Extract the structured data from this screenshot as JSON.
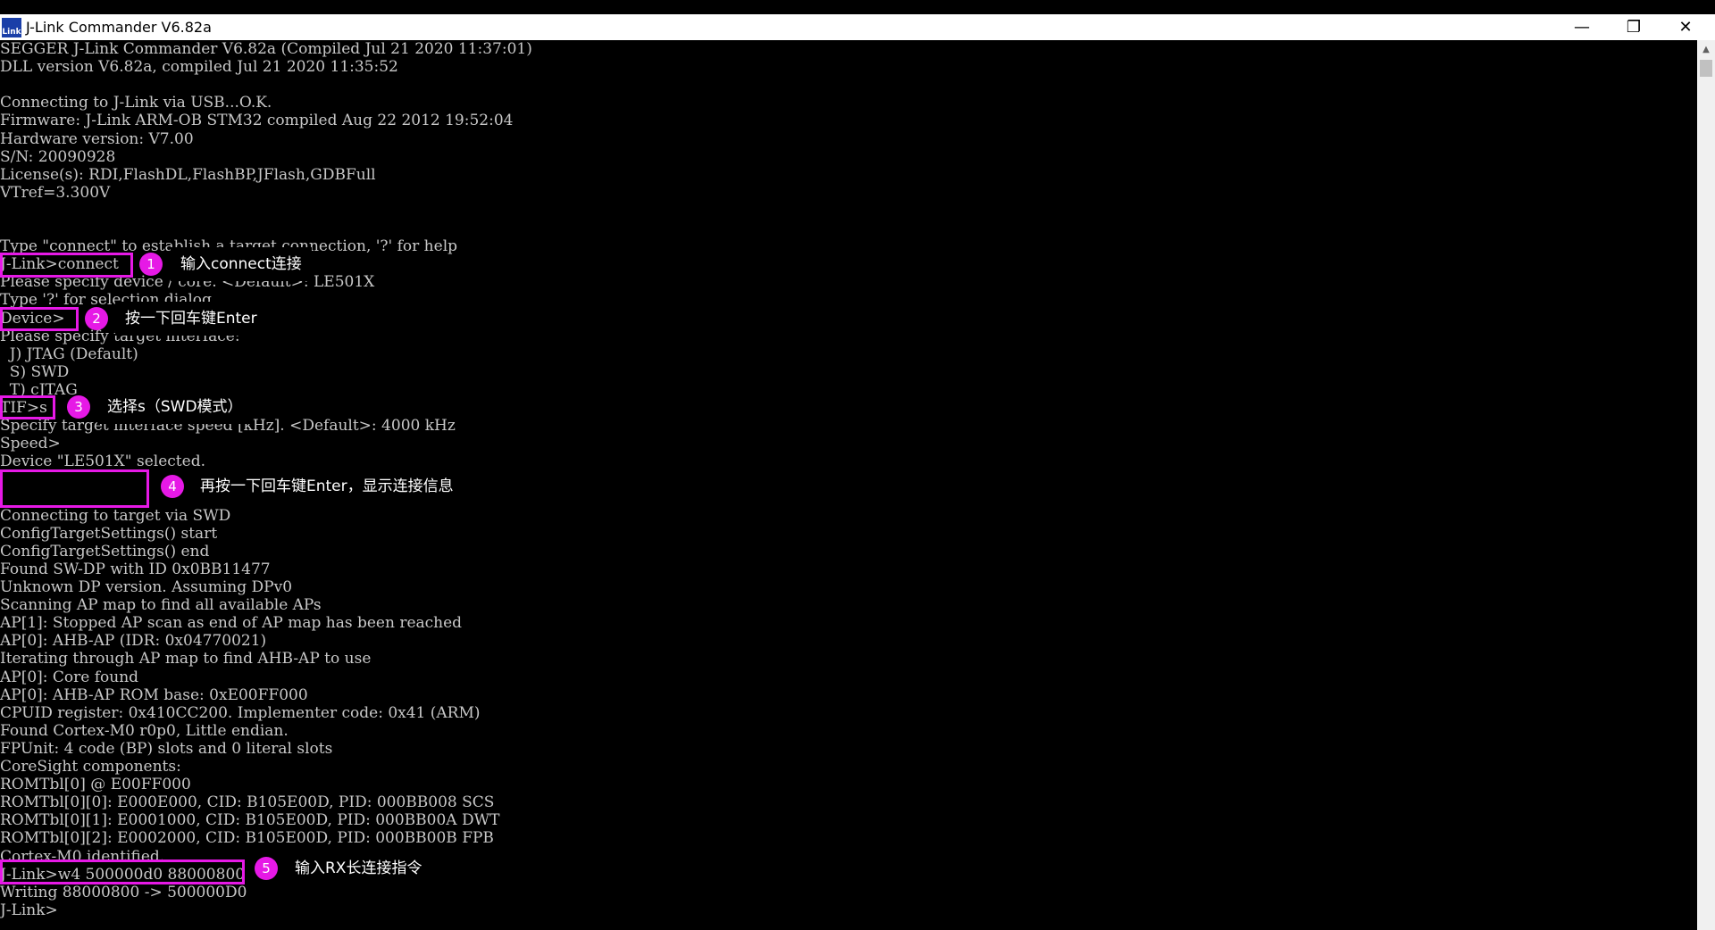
{
  "window": {
    "title": "J-Link Commander V6.82a",
    "icon_text": "Link",
    "minimize_glyph": "—",
    "maximize_glyph": "❐",
    "close_glyph": "✕",
    "scroll_up_glyph": "▲"
  },
  "terminal": {
    "lines": [
      "SEGGER J-Link Commander V6.82a (Compiled Jul 21 2020 11:37:01)",
      "DLL version V6.82a, compiled Jul 21 2020 11:35:52",
      "",
      "Connecting to J-Link via USB...O.K.",
      "Firmware: J-Link ARM-OB STM32 compiled Aug 22 2012 19:52:04",
      "Hardware version: V7.00",
      "S/N: 20090928",
      "License(s): RDI,FlashDL,FlashBP,JFlash,GDBFull",
      "VTref=3.300V",
      "",
      "",
      "Type \"connect\" to establish a target connection, '?' for help",
      "J-Link>connect",
      "Please specify device / core. <Default>: LE501X",
      "Type '?' for selection dialog",
      "Device>",
      "Please specify target interface:",
      "  J) JTAG (Default)",
      "  S) SWD",
      "  T) cJTAG",
      "TIF>s",
      "Specify target interface speed [kHz]. <Default>: 4000 kHz",
      "Speed>",
      "Device \"LE501X\" selected.",
      "",
      "",
      "Connecting to target via SWD",
      "ConfigTargetSettings() start",
      "ConfigTargetSettings() end",
      "Found SW-DP with ID 0x0BB11477",
      "Unknown DP version. Assuming DPv0",
      "Scanning AP map to find all available APs",
      "AP[1]: Stopped AP scan as end of AP map has been reached",
      "AP[0]: AHB-AP (IDR: 0x04770021)",
      "Iterating through AP map to find AHB-AP to use",
      "AP[0]: Core found",
      "AP[0]: AHB-AP ROM base: 0xE00FF000",
      "CPUID register: 0x410CC200. Implementer code: 0x41 (ARM)",
      "Found Cortex-M0 r0p0, Little endian.",
      "FPUnit: 4 code (BP) slots and 0 literal slots",
      "CoreSight components:",
      "ROMTbl[0] @ E00FF000",
      "ROMTbl[0][0]: E000E000, CID: B105E00D, PID: 000BB008 SCS",
      "ROMTbl[0][1]: E0001000, CID: B105E00D, PID: 000BB00A DWT",
      "ROMTbl[0][2]: E0002000, CID: B105E00D, PID: 000BB00B FPB",
      "Cortex-M0 identified.",
      "J-Link>w4 500000d0 88000800",
      "Writing 88000800 -> 500000D0",
      "J-Link>"
    ]
  },
  "annotations": [
    {
      "number": "1",
      "text": "输入connect连接"
    },
    {
      "number": "2",
      "text": "按一下回车键Enter"
    },
    {
      "number": "3",
      "text": "选择s（SWD模式）"
    },
    {
      "number": "4",
      "text": "再按一下回车键Enter，显示连接信息"
    },
    {
      "number": "5",
      "text": "输入RX长连接指令"
    }
  ],
  "colors": {
    "terminal_bg": "#000000",
    "terminal_text": "#c8c8c8",
    "highlight": "#e619e6"
  }
}
